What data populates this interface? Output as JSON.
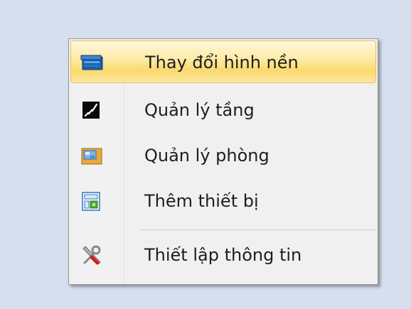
{
  "menu": {
    "items": [
      {
        "label": "Thay đổi hình nền",
        "icon": "wallpaper-icon",
        "highlighted": true
      },
      {
        "label": "Quản lý tầng",
        "icon": "floor-icon"
      },
      {
        "label": "Quản lý phòng",
        "icon": "room-icon"
      },
      {
        "label": "Thêm thiết bị",
        "icon": "add-device-icon"
      },
      {
        "label": "Thiết lập thông tin",
        "icon": "settings-tools-icon"
      }
    ]
  },
  "colors": {
    "background": "#d6dfee",
    "highlight": "#fbd96d",
    "highlight_border": "#e8c05c",
    "text": "#1e1e1e"
  }
}
